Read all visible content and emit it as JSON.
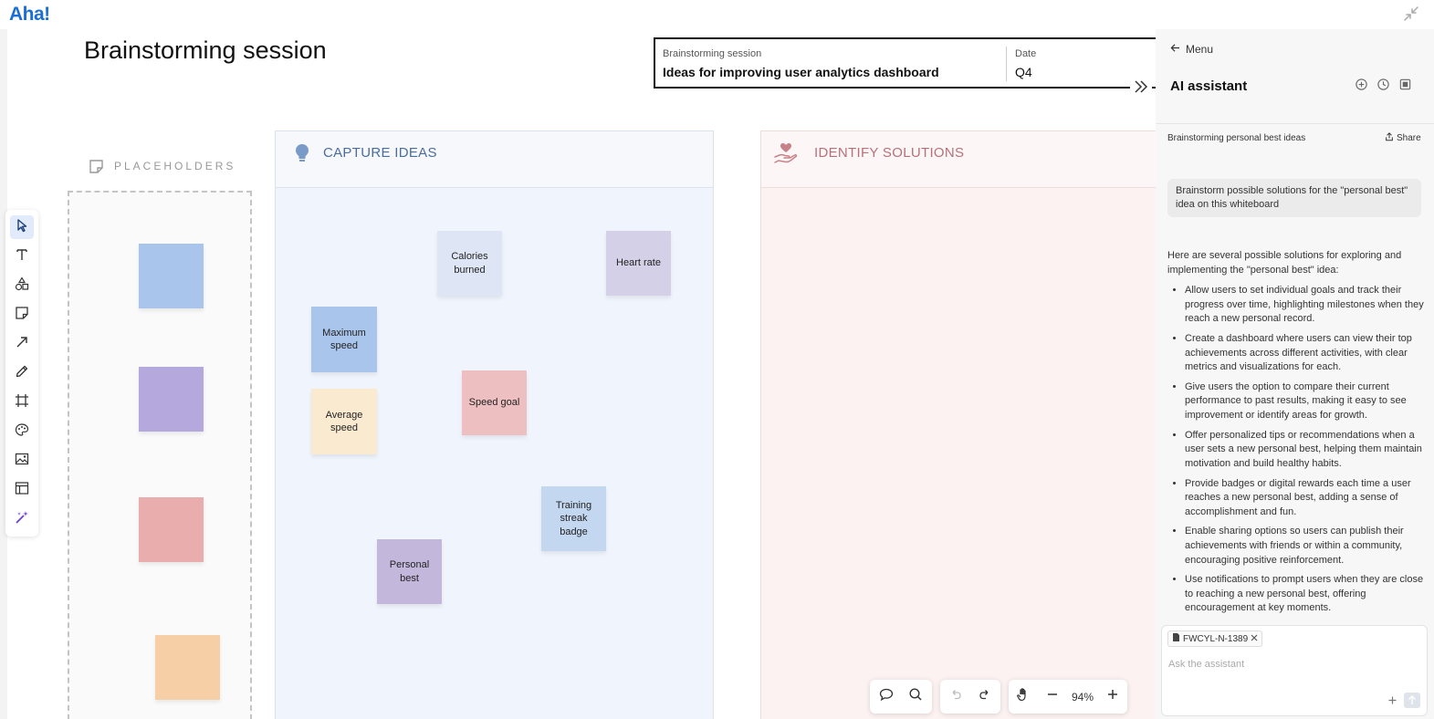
{
  "app": {
    "logo_text": "Aha!"
  },
  "board": {
    "title": "Brainstorming session"
  },
  "header_card": {
    "label1": "Brainstorming session",
    "value1": "Ideas for improving user analytics dashboard",
    "label2": "Date",
    "value2": "Q4"
  },
  "placeholders": {
    "title": "PLACEHOLDERS",
    "stickies": [
      {
        "color": "#a9c5ec"
      },
      {
        "color": "#b4a8dc"
      },
      {
        "color": "#eaadae"
      },
      {
        "color": "#f7cfa6"
      }
    ]
  },
  "columns": {
    "capture": {
      "title": "CAPTURE IDEAS",
      "accent": "#4a6d9c"
    },
    "solutions": {
      "title": "IDENTIFY SOLUTIONS",
      "accent": "#b5707a"
    }
  },
  "stickies": [
    {
      "label": "Calories burned",
      "color": "#dee6f5"
    },
    {
      "label": "Heart rate",
      "color": "#d3d0e7"
    },
    {
      "label": "Maximum speed",
      "color": "#a9c5ec"
    },
    {
      "label": "Average speed",
      "color": "#faebd0"
    },
    {
      "label": "Speed goal",
      "color": "#eebfc0"
    },
    {
      "label": "Training streak badge",
      "color": "#c4d7f1"
    },
    {
      "label": "Personal best",
      "color": "#c3b8dc"
    }
  ],
  "toolbar": {
    "tools": [
      "select-icon",
      "text-icon",
      "shapes-icon",
      "sticky-note-icon",
      "arrow-icon",
      "pen-icon",
      "frame-icon",
      "palette-icon",
      "image-icon",
      "template-icon",
      "ai-wand-icon"
    ]
  },
  "controls": {
    "zoom": "94%"
  },
  "ai_panel": {
    "menu_label": "Menu",
    "title": "AI assistant",
    "thread_title": "Brainstorming personal best ideas",
    "share_label": "Share",
    "prompt": "Brainstorm possible solutions for the \"personal best\" idea on this whiteboard",
    "answer_intro": "Here are several possible solutions for exploring and implementing the \"personal best\" idea:",
    "answer_items": [
      "Allow users to set individual goals and track their progress over time, highlighting milestones when they reach a new personal record.",
      "Create a dashboard where users can view their top achievements across different activities, with clear metrics and visualizations for each.",
      "Give users the option to compare their current performance to past results, making it easy to see improvement or identify areas for growth.",
      "Offer personalized tips or recommendations when a user sets a new personal best, helping them maintain motivation and build healthy habits.",
      "Provide badges or digital rewards each time a user reaches a new personal best, adding a sense of accomplishment and fun.",
      "Enable sharing options so users can publish their achievements with friends or within a community, encouraging positive reinforcement.",
      "Use notifications to prompt users when they are close to reaching a new personal best, offering encouragement at key moments."
    ],
    "chip_label": "FWCYL-N-1389",
    "input_placeholder": "Ask the assistant"
  }
}
